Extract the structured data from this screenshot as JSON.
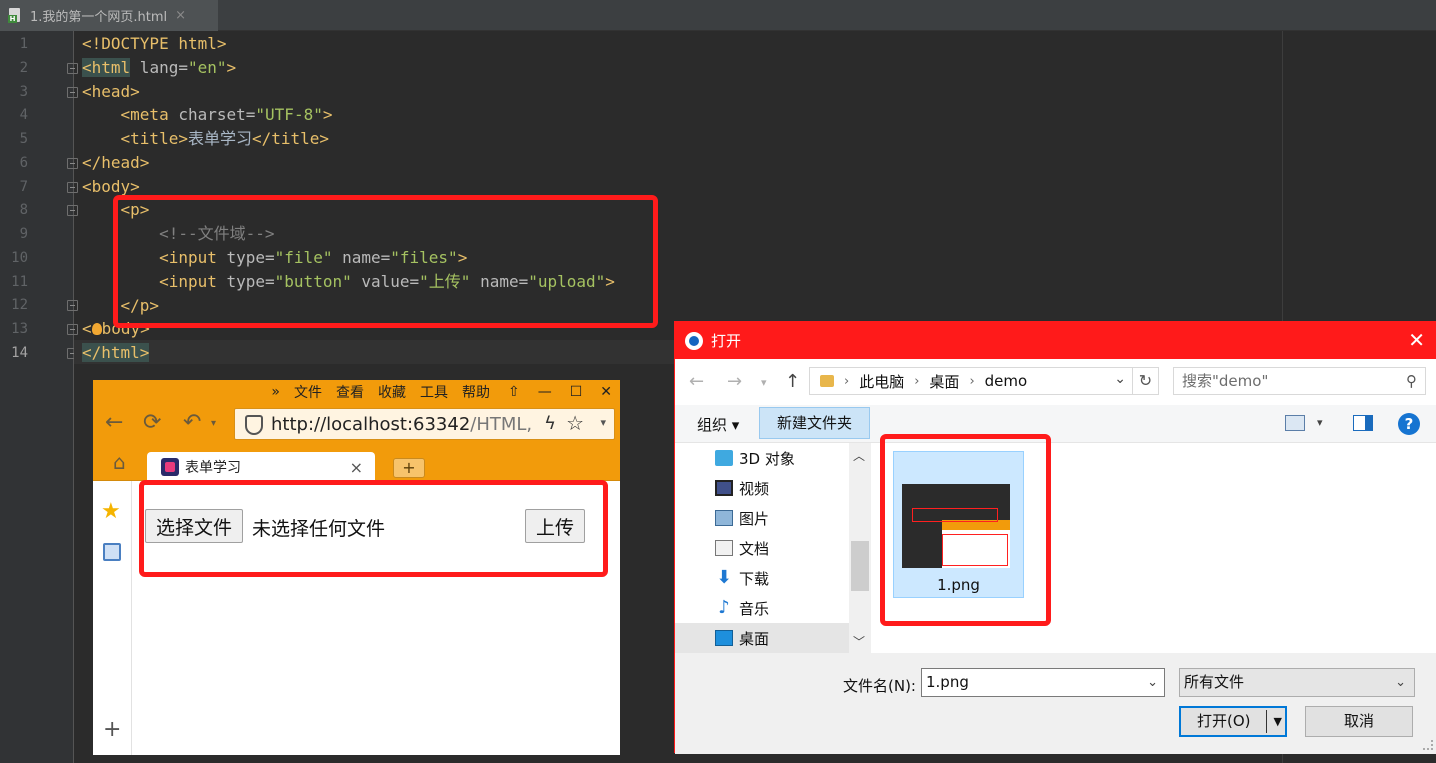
{
  "ide": {
    "tab_title": "1.我的第一个网页.html",
    "tab_close": "×",
    "line_numbers": [
      "1",
      "2",
      "3",
      "4",
      "5",
      "6",
      "7",
      "8",
      "9",
      "10",
      "11",
      "12",
      "13",
      "14"
    ],
    "code": {
      "l1": "<!DOCTYPE html>",
      "l2_tag": "<html",
      "l2_attr": " lang=",
      "l2_val": "\"en\"",
      "l2_end": ">",
      "l3": "<head>",
      "l4_open": "<meta",
      "l4_attr": " charset=",
      "l4_val": "\"UTF-8\"",
      "l4_end": ">",
      "l5_open": "<title>",
      "l5_text": "表单学习",
      "l5_close": "</title>",
      "l6": "</head>",
      "l7": "<body>",
      "l8": "<p>",
      "l9": "<!--文件域-->",
      "l10_open": "<input",
      "l10_a1": " type=",
      "l10_v1": "\"file\"",
      "l10_a2": " name=",
      "l10_v2": "\"files\"",
      "l10_end": ">",
      "l11_open": "<input",
      "l11_a1": " type=",
      "l11_v1": "\"button\"",
      "l11_a2": " value=",
      "l11_v2": "\"上传\"",
      "l11_a3": " name=",
      "l11_v3": "\"upload\"",
      "l11_end": ">",
      "l12": "</p>",
      "l13_a": "<",
      "l13_b": "body>",
      "l14": "</html>"
    }
  },
  "browser": {
    "menu": [
      "»",
      "文件",
      "查看",
      "收藏",
      "工具",
      "帮助"
    ],
    "url_host": "http://localhost:63342",
    "url_path": "/HTML,",
    "tab_title": "表单学习",
    "tab_close": "×",
    "new_tab": "+",
    "file_button": "选择文件",
    "file_status": "未选择任何文件",
    "upload_button": "上传",
    "side_add": "+"
  },
  "dialog": {
    "title": "打开",
    "close": "✕",
    "breadcrumb": [
      "此电脑",
      "桌面",
      "demo"
    ],
    "search_placeholder": "搜索\"demo\"",
    "organize": "组织 ▾",
    "new_folder": "新建文件夹",
    "help": "?",
    "tree": [
      "3D 对象",
      "视频",
      "图片",
      "文档",
      "下载",
      "音乐",
      "桌面"
    ],
    "file_name": "1.png",
    "filename_label": "文件名(N):",
    "filename_value": "1.png",
    "filetype": "所有文件",
    "open_button": "打开(O)",
    "cancel_button": "取消"
  },
  "colors": {
    "highlight_red": "#ff1b1b",
    "browser_orange": "#f29b0b",
    "dialog_title": "#ff1a1a"
  }
}
